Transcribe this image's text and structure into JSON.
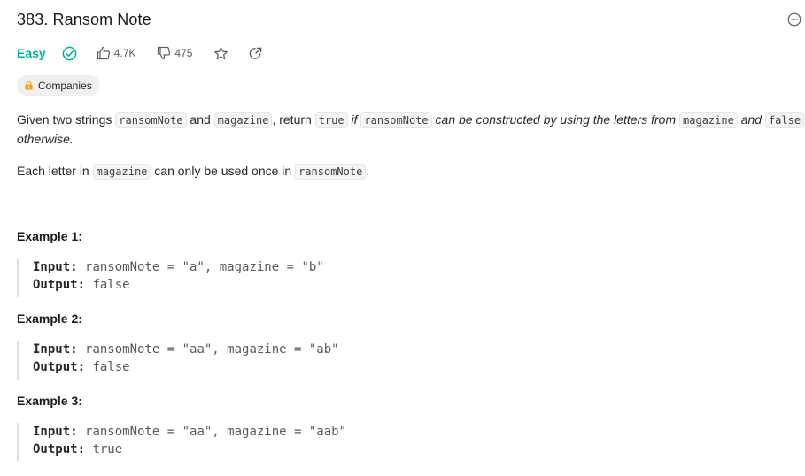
{
  "problem": {
    "title": "383. Ransom Note",
    "difficulty": "Easy",
    "likes": "4.7K",
    "dislikes": "475",
    "tag_label": "Companies"
  },
  "description": {
    "p1": {
      "t1": "Given two strings ",
      "c1": "ransomNote",
      "t2": " and ",
      "c2": "magazine",
      "t3": ", return ",
      "c3": "true",
      "t4": " if ",
      "c4": "ransomNote",
      "t5": " can be constructed by using the letters from ",
      "c5": "magazine",
      "t6": " and ",
      "c6": "false",
      "t7": "otherwise."
    },
    "p2": {
      "t1": "Each letter in ",
      "c1": "magazine",
      "t2": " can only be used once in ",
      "c2": "ransomNote",
      "t3": "."
    }
  },
  "examples": [
    {
      "heading": "Example 1:",
      "input_label": "Input:",
      "input": "ransomNote = \"a\", magazine = \"b\"",
      "output_label": "Output:",
      "output": "false"
    },
    {
      "heading": "Example 2:",
      "input_label": "Input:",
      "input": "ransomNote = \"aa\", magazine = \"ab\"",
      "output_label": "Output:",
      "output": "false"
    },
    {
      "heading": "Example 3:",
      "input_label": "Input:",
      "input": "ransomNote = \"aa\", magazine = \"aab\"",
      "output_label": "Output:",
      "output": "true"
    }
  ],
  "colors": {
    "easy": "#00af9b",
    "tag_bg": "#f0f0f0",
    "lock": "#ffa116"
  },
  "icons": [
    "check-circle-icon",
    "thumbs-up-icon",
    "thumbs-down-icon",
    "star-icon",
    "share-icon",
    "more-icon",
    "lock-icon"
  ]
}
